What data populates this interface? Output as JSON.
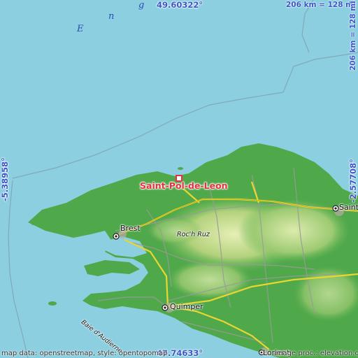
{
  "coordinates": {
    "north": "49.60322°",
    "south": "47.74633°",
    "west": "-5.38958°",
    "east": "-2.57708°"
  },
  "scale": {
    "horizontal": "206 km = 128 mi",
    "vertical": "206 km = 128 mi"
  },
  "sea_label_letters": [
    "E",
    "n",
    "g"
  ],
  "places": {
    "main_city": "Saint-Pol-de-Leon",
    "brest": "Brest",
    "quimper": "Quimper",
    "roch_ruz": "Roc'h Ruz",
    "baie": "Baie d'Audierne",
    "saint_right": "Saint",
    "lorient": "Lorient"
  },
  "credits": {
    "left": "map data: openstreetmap, style: opentopomap",
    "right": "image proc.: elevation.city"
  },
  "colors": {
    "sea": "#8ccfe0",
    "lowland": "#4fa84a",
    "highland": "#d8e6a0",
    "coord_text": "#3a56c8",
    "marker": "#ea2f3e"
  }
}
